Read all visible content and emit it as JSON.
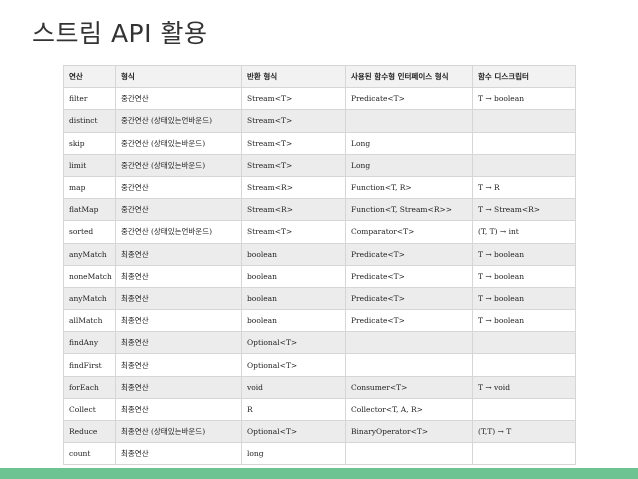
{
  "slide": {
    "title": "스트림 API 활용",
    "accent_color": "#6ec393"
  },
  "table": {
    "headers": [
      "연산",
      "형식",
      "반환 형식",
      "사용된 함수형 인터페이스 형식",
      "함수 디스크립터"
    ],
    "rows": [
      [
        "filter",
        "중간연산",
        "Stream<T>",
        "Predicate<T>",
        "T → boolean"
      ],
      [
        "distinct",
        "중간연산 (상태있는언바운드)",
        "Stream<T>",
        "",
        ""
      ],
      [
        "skip",
        "중간연산 (상태있는바운드)",
        "Stream<T>",
        "Long",
        ""
      ],
      [
        "limit",
        "중간연산 (상태있는바운드)",
        "Stream<T>",
        "Long",
        ""
      ],
      [
        "map",
        "중간연산",
        "Stream<R>",
        "Function<T, R>",
        "T → R"
      ],
      [
        "flatMap",
        "중간연산",
        "Stream<R>",
        "Function<T, Stream<R>>",
        "T → Stream<R>"
      ],
      [
        "sorted",
        "중간연산 (상태있는언바운드)",
        "Stream<T>",
        "Comparator<T>",
        "(T, T) → int"
      ],
      [
        "anyMatch",
        "최종연산",
        "boolean",
        "Predicate<T>",
        "T → boolean"
      ],
      [
        "noneMatch",
        "최종연산",
        "boolean",
        "Predicate<T>",
        "T → boolean"
      ],
      [
        "anyMatch",
        "최종연산",
        "boolean",
        "Predicate<T>",
        "T → boolean"
      ],
      [
        "allMatch",
        "최종연산",
        "boolean",
        "Predicate<T>",
        "T → boolean"
      ],
      [
        "findAny",
        "최종연산",
        "Optional<T>",
        "",
        ""
      ],
      [
        "findFirst",
        "최종연산",
        "Optional<T>",
        "",
        ""
      ],
      [
        "forEach",
        "최종연산",
        "void",
        "Consumer<T>",
        "T → void"
      ],
      [
        "Collect",
        "최종연산",
        "R",
        "Collector<T, A, R>",
        ""
      ],
      [
        "Reduce",
        "최종연산 (상태있는바운드)",
        "Optional<T>",
        "BinaryOperator<T>",
        "(T,T) → T"
      ],
      [
        "count",
        "최종연산",
        "long",
        "",
        ""
      ]
    ]
  }
}
